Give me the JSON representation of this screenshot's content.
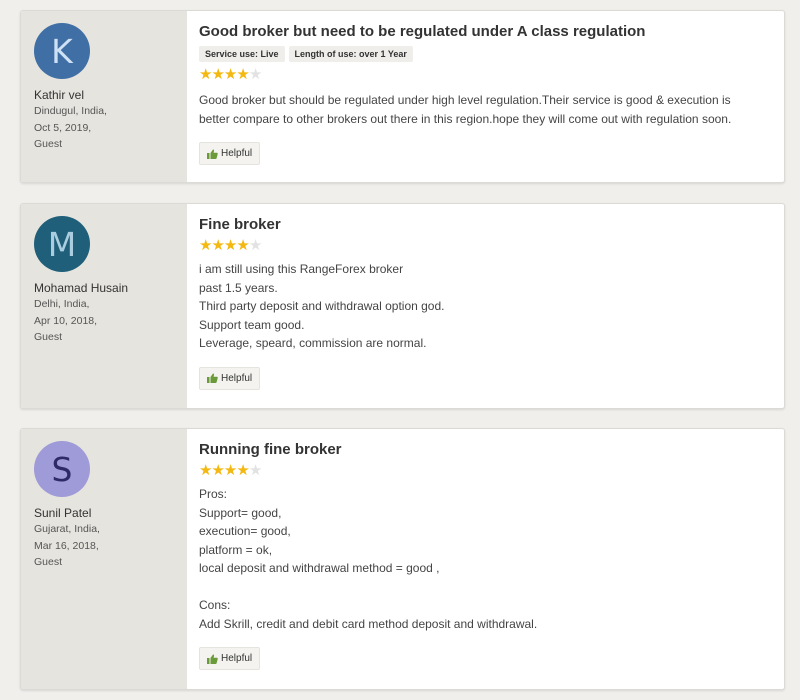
{
  "reviews": [
    {
      "avatar_letter": "K",
      "user_name": "Kathir vel",
      "location": "Dindugul, India,",
      "date": "Oct 5, 2019,",
      "role": "Guest",
      "title": "Good broker but need to be regulated under A class regulation",
      "tags": [
        "Service use: Live",
        "Length of use: over 1 Year"
      ],
      "rating": 4,
      "body_lines": [
        "Good broker but should be regulated under high level regulation.Their service is good & execution is",
        "better compare to other brokers out there in this region.hope they will come out with regulation soon."
      ],
      "helpful_label": "Helpful"
    },
    {
      "avatar_letter": "M",
      "user_name": "Mohamad Husain",
      "location": "Delhi, India,",
      "date": "Apr 10, 2018,",
      "role": "Guest",
      "title": "Fine broker",
      "tags": [],
      "rating": 4,
      "body_lines": [
        "i am still using this RangeForex broker",
        "past 1.5 years.",
        "Third party deposit and withdrawal option god.",
        "Support team good.",
        "Leverage, speard, commission are normal."
      ],
      "helpful_label": "Helpful"
    },
    {
      "avatar_letter": "S",
      "user_name": "Sunil Patel",
      "location": "Gujarat, India,",
      "date": "Mar 16, 2018,",
      "role": "Guest",
      "title": "Running fine broker",
      "tags": [],
      "rating": 4,
      "body_lines": [
        "Pros:",
        "Support= good,",
        "execution= good,",
        "platform = ok,",
        "local deposit and withdrawal method = good ,",
        "",
        "Cons:",
        "Add Skrill, credit and debit card method deposit and withdrawal."
      ],
      "helpful_label": "Helpful"
    }
  ],
  "colors": {
    "star_on": "#f3b811",
    "star_off": "#e2e2e2",
    "thumb": "#6a9a3a"
  }
}
